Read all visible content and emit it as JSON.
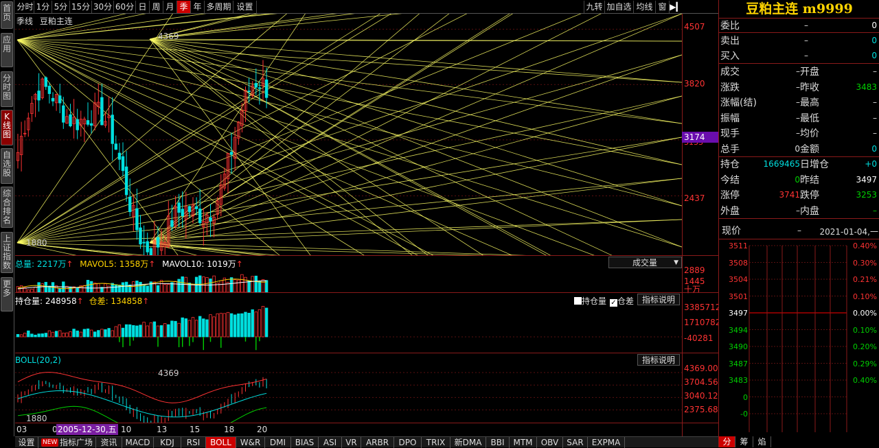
{
  "sidebar": {
    "items": [
      "首页",
      "应用",
      "分时图",
      "K线图",
      "自选股",
      "综合排名",
      "上证指数",
      "更多"
    ]
  },
  "topbar": {
    "periods": [
      "分时",
      "1分",
      "5分",
      "15分",
      "30分",
      "60分",
      "日",
      "周",
      "月",
      "季",
      "年",
      "多周期",
      "设置"
    ],
    "active_period": "季",
    "tools": [
      "九转",
      "加自选",
      "均线",
      "窗"
    ]
  },
  "main_chart": {
    "period_label": "季线",
    "instrument_label": "豆粕主连",
    "price_labels": [
      "4507",
      "3820",
      "3174",
      "3133",
      "2437"
    ],
    "current_price": "3174",
    "high_marker": "4369",
    "low_marker": "1880",
    "colors": {
      "up": "#ff3333",
      "down": "#00e0e0",
      "gann": "#ffff66",
      "axis": "#ff3333"
    }
  },
  "volume_panel": {
    "total_label": "总量: 2217万",
    "mavol5_label": "MAVOL5: 1358万",
    "mavol10_label": "MAVOL10: 1019万",
    "dropdown": "成交量",
    "axis": [
      "2889",
      "1445",
      "十万"
    ]
  },
  "oi_panel": {
    "oi_label": "持仓量: 248958",
    "diff_label": "仓差: 134858",
    "check_oi": "持仓量",
    "check_diff": "仓差",
    "explain": "指标说明",
    "axis": [
      "3385712",
      "1710782",
      "-40281"
    ]
  },
  "boll_panel": {
    "label": "BOLL(20,2)",
    "explain": "指标说明",
    "high_marker": "4369",
    "low_marker": "1880",
    "axis": [
      "4369.00",
      "3704.56",
      "3040.12",
      "2375.68"
    ]
  },
  "x_axis": {
    "labels": [
      "03",
      "0",
      "10",
      "13",
      "15",
      "18",
      "20"
    ],
    "cursor_date": "2005-12-30,五"
  },
  "bottom_tabs": {
    "items": [
      "设置",
      "指标广场",
      "资讯",
      "MACD",
      "KDJ",
      "RSI",
      "BOLL",
      "W&R",
      "DMI",
      "BIAS",
      "ASI",
      "VR",
      "ARBR",
      "DPO",
      "TRIX",
      "新DMA",
      "BBI",
      "MTM",
      "OBV",
      "SAR",
      "EXPMA"
    ],
    "active": "BOLL",
    "new_badge": "NEW"
  },
  "quote_panel": {
    "title": "豆粕主连 m9999",
    "order_rows": [
      {
        "label": "委比",
        "mid": "–",
        "value": "0"
      },
      {
        "label": "卖出",
        "mid": "–",
        "value": "0"
      },
      {
        "label": "买入",
        "mid": "–",
        "value": "0"
      }
    ],
    "detail_rows": [
      {
        "l1": "成交",
        "v1": "–",
        "l2": "开盘",
        "v2": "–"
      },
      {
        "l1": "涨跌",
        "v1": "–",
        "l2": "昨收",
        "v2": "3483"
      },
      {
        "l1": "涨幅(结)",
        "v1": "–",
        "l2": "最高",
        "v2": "–"
      },
      {
        "l1": "振幅",
        "v1": "–",
        "l2": "最低",
        "v2": "–"
      },
      {
        "l1": "现手",
        "v1": "–",
        "l2": "均价",
        "v2": "–"
      },
      {
        "l1": "总手",
        "v1": "0",
        "l2": "金额",
        "v2": "0"
      }
    ],
    "futures_rows": [
      {
        "l1": "持仓",
        "v1": "1669465",
        "l2": "日增仓",
        "v2": "+0"
      },
      {
        "l1": "今结",
        "v1": "0",
        "l2": "昨结",
        "v2": "3497"
      },
      {
        "l1": "涨停",
        "v1": "3741",
        "l2": "跌停",
        "v2": "3253"
      },
      {
        "l1": "外盘",
        "v1": "–",
        "l2": "内盘",
        "v2": "–"
      }
    ],
    "current_label": "现价",
    "current_value": "–",
    "current_date": "2021-01-04,一",
    "mini_prices": [
      "3511",
      "3508",
      "3504",
      "3501",
      "3497",
      "3494",
      "3490",
      "3487",
      "3483",
      "0",
      "-0"
    ],
    "mini_pcts": [
      "0.40%",
      "0.30%",
      "0.21%",
      "0.10%",
      "0.00%",
      "0.10%",
      "0.20%",
      "0.29%",
      "0.40%"
    ],
    "tabs": [
      "分",
      "筹",
      "焰"
    ]
  }
}
